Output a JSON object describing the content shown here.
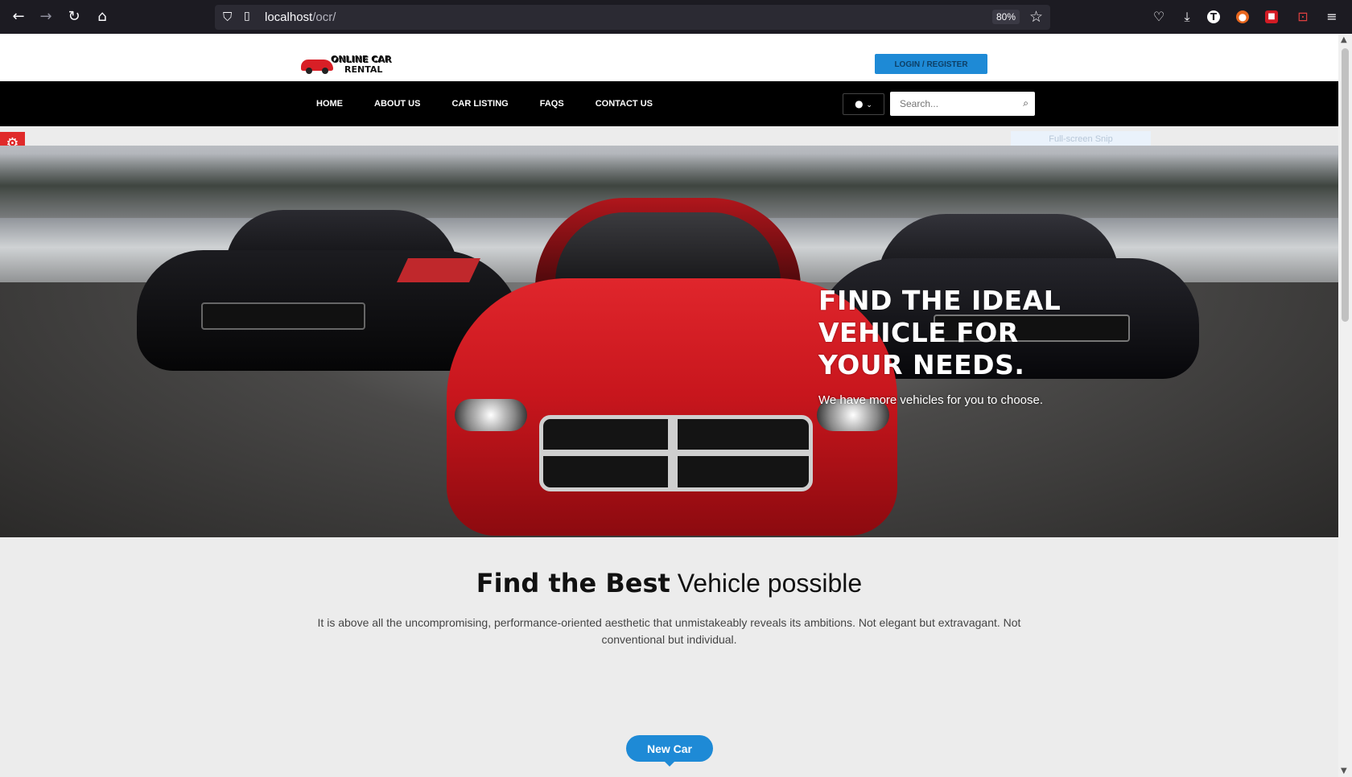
{
  "browser": {
    "url_host": "localhost",
    "url_path": "/ocr/",
    "zoom": "80%",
    "icons": [
      "back-icon",
      "forward-icon",
      "reload-icon",
      "home-icon",
      "shield-icon",
      "page-icon",
      "star-icon",
      "pocket-icon",
      "download-icon",
      "extension-t-icon",
      "extension-fox-icon",
      "extension-lock-icon",
      "screenshot-icon",
      "menu-icon"
    ]
  },
  "header": {
    "logo_line1": "ONLINE CAR",
    "logo_line2": "RENTAL",
    "login_label": "LOGIN / REGISTER"
  },
  "nav": {
    "items": [
      "HOME",
      "ABOUT US",
      "CAR LISTING",
      "FAQS",
      "CONTACT US"
    ],
    "search_placeholder": "Search..."
  },
  "overlay": {
    "snip_tooltip": "Full-screen Snip"
  },
  "hero": {
    "title": "FIND THE IDEAL VEHICLE FOR YOUR NEEDS.",
    "subtitle": "We have more vehicles for you to choose."
  },
  "intro": {
    "heading_bold": "Find the Best",
    "heading_rest": "Vehicle possible",
    "text": "It is above all the uncompromising, performance-oriented aesthetic that unmistakeably reveals its ambitions. Not elegant but extravagant. Not conventional but individual.",
    "button": "New Car"
  },
  "colors": {
    "accent": "#1e8ad6",
    "nav_bg": "#000000",
    "settings_tab": "#e02a2a"
  }
}
